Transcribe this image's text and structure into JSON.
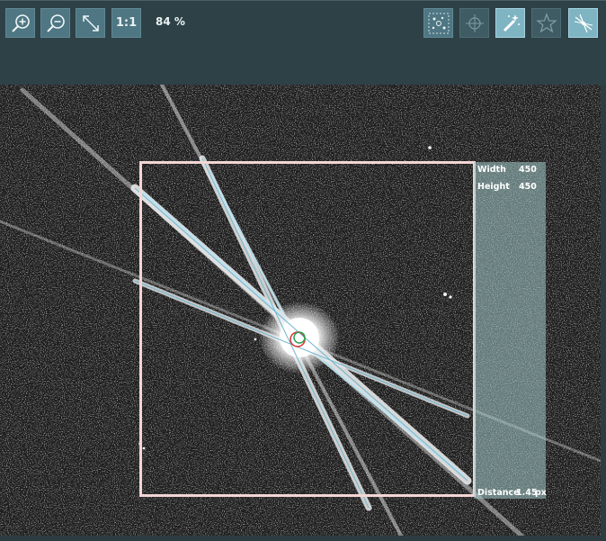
{
  "toolbar": {
    "zoom_level": "84 %",
    "one_to_one_label": "1:1",
    "buttons": [
      {
        "name": "zoom-in",
        "icon": "zoom-in-icon"
      },
      {
        "name": "zoom-out",
        "icon": "zoom-out-icon"
      },
      {
        "name": "fit-to-window",
        "icon": "diagonal-arrow-icon"
      },
      {
        "name": "actual-size",
        "icon": "one-to-one-icon"
      },
      {
        "name": "star-detection",
        "icon": "star-field-icon"
      },
      {
        "name": "crosshair",
        "icon": "crosshair-icon"
      },
      {
        "name": "magic-wand",
        "icon": "magic-wand-icon"
      },
      {
        "name": "star-shape",
        "icon": "star-icon"
      },
      {
        "name": "diffraction-spikes",
        "icon": "diffraction-spikes-icon"
      }
    ]
  },
  "measurement": {
    "width_label": "Width",
    "width_value": "450",
    "height_label": "Height",
    "height_value": "450",
    "distance_label": "Distance",
    "distance_value": "1.45",
    "distance_unit": "px"
  },
  "colors": {
    "accent": "#7fb4c3",
    "toolbar_bg": "#2e4147",
    "selection_box": "#f3d6d4",
    "spike_fit_line": "#6fb6cf",
    "inner_circle": "#2f9f4f",
    "outer_circle": "#d83030"
  }
}
